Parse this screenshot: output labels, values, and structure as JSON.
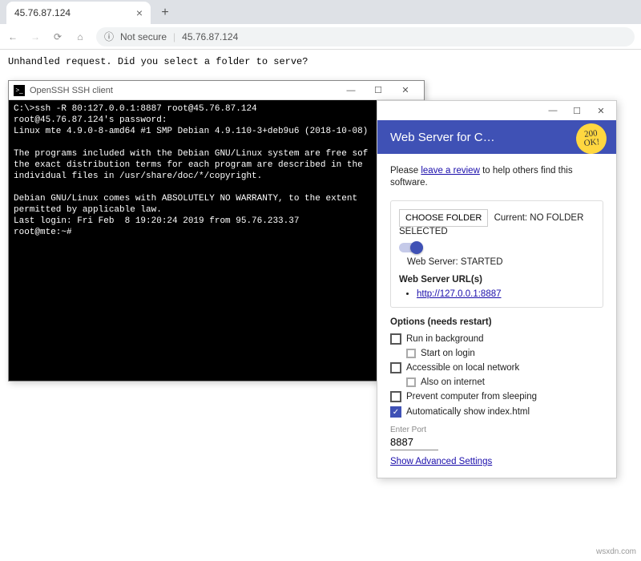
{
  "browser": {
    "tab_title": "45.76.87.124",
    "not_secure": "Not secure",
    "url": "45.76.87.124",
    "page_text": "Unhandled request. Did you select a folder to serve?"
  },
  "ssh": {
    "title": "OpenSSH SSH client",
    "body": "C:\\>ssh -R 80:127.0.0.1:8887 root@45.76.87.124\nroot@45.76.87.124's password:\nLinux mte 4.9.0-8-amd64 #1 SMP Debian 4.9.110-3+deb9u6 (2018-10-08)\n\nThe programs included with the Debian GNU/Linux system are free sof\nthe exact distribution terms for each program are described in the\nindividual files in /usr/share/doc/*/copyright.\n\nDebian GNU/Linux comes with ABSOLUTELY NO WARRANTY, to the extent\npermitted by applicable law.\nLast login: Fri Feb  8 19:20:24 2019 from 95.76.233.37\nroot@mte:~#"
  },
  "ws": {
    "title": "Web Server for C…",
    "badge": "200 OK!",
    "review_pre": "Please ",
    "review_link": "leave a review",
    "review_post": " to help others find this software.",
    "choose_label": "CHOOSE FOLDER",
    "current_label": "Current: NO FOLDER SELECTED",
    "status": "Web Server: STARTED",
    "urls_title": "Web Server URL(s)",
    "url1": "http://127.0.0.1:8887",
    "options_title": "Options (needs restart)",
    "opts": {
      "run_bg": "Run in background",
      "start_login": "Start on login",
      "local_net": "Accessible on local network",
      "also_internet": "Also on internet",
      "prevent_sleep": "Prevent computer from sleeping",
      "auto_index": "Automatically show index.html"
    },
    "port_label": "Enter Port",
    "port_value": "8887",
    "advanced": "Show Advanced Settings"
  },
  "watermark": "wsxdn.com"
}
